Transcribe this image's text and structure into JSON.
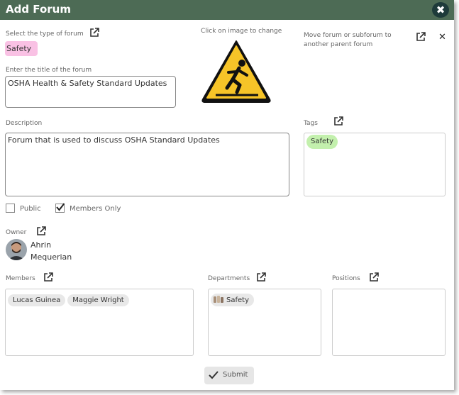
{
  "dialog": {
    "title": "Add Forum",
    "close_icon": "close-icon"
  },
  "forum_type": {
    "label": "Select the type of forum",
    "value": "Safety"
  },
  "image": {
    "hint": "Click on image to change",
    "icon": "wet-floor-warning-sign"
  },
  "move_forum": {
    "label_line1": "Move forum or subforum to",
    "label_line2": "another parent forum"
  },
  "title_field": {
    "label": "Enter the title of the forum",
    "value": "OSHA Health & Safety Standard Updates"
  },
  "description": {
    "label": "Description",
    "value": "Forum that is used to discuss OSHA Standard Updates"
  },
  "tags": {
    "label": "Tags",
    "items": [
      "Safety"
    ]
  },
  "visibility": {
    "public_label": "Public",
    "public_checked": false,
    "members_only_label": "Members Only",
    "members_only_checked": true
  },
  "owner": {
    "label": "Owner",
    "first_name": "Ahrin",
    "last_name": "Mequerian"
  },
  "members": {
    "label": "Members",
    "items": [
      "Lucas Guinea",
      "Maggie Wright"
    ]
  },
  "departments": {
    "label": "Departments",
    "items": [
      "Safety"
    ]
  },
  "positions": {
    "label": "Positions",
    "items": []
  },
  "submit": {
    "label": "Submit"
  },
  "colors": {
    "titlebar": "#4d6b55",
    "type_badge": "#f9c1e4",
    "tag_chip": "#c3f0ad"
  }
}
